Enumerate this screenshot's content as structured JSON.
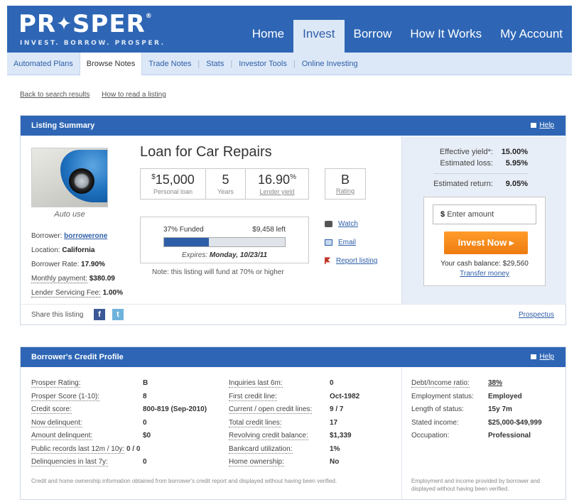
{
  "brand": {
    "logo_left": "PR",
    "logo_right": "SPER",
    "tagline": "INVEST. BORROW. PROSPER."
  },
  "nav": [
    "Home",
    "Invest",
    "Borrow",
    "How It Works",
    "My Account"
  ],
  "subnav": [
    "Automated Plans",
    "Browse Notes",
    "Trade Notes",
    "Stats",
    "Investor Tools",
    "Online Investing"
  ],
  "crumbs": [
    "Back to search results",
    "How to read a listing"
  ],
  "listing": {
    "header": "Listing Summary",
    "help": "Help",
    "title": "Loan for Car Repairs",
    "image_caption": "Auto use",
    "amount": {
      "prefix": "$",
      "value": "15,000",
      "label": "Personal loan"
    },
    "years": {
      "value": "5",
      "label": "Years"
    },
    "lender_yield": {
      "value": "16.90",
      "unit": "%",
      "label": "Lender yield"
    },
    "rating": {
      "value": "B",
      "label": "Rating"
    },
    "funded_label": "37% Funded",
    "funded_fraction": 0.37,
    "left_label": "$9,458 left",
    "expires_label": "Expires:",
    "expires_value": "Monday, 10/23/11",
    "fund_note": "Note: this listing will fund at 70% or higher",
    "actions": [
      "Watch",
      "Email",
      "Report listing"
    ],
    "borrower": [
      {
        "k": "Borrower:",
        "v": "borrowerone"
      },
      {
        "k": "Location:",
        "v": "California"
      },
      {
        "k": "Borrower Rate:",
        "v": "17.90%"
      },
      {
        "k": "Monthly payment:",
        "v": "$380.09"
      },
      {
        "k": "Lender Servicing Fee:",
        "v": "1.00%"
      }
    ],
    "effective_yield_label": "Effective yield*:",
    "effective_yield": "15.00%",
    "estimated_loss_label": "Estimated loss:",
    "estimated_loss": "5.95%",
    "estimated_return_label": "Estimated return:",
    "estimated_return": "9.05%",
    "amount_placeholder": "Enter amount",
    "amount_currency": "$",
    "invest_button": "Invest Now",
    "cash_balance": "Your cash balance: $29,560",
    "transfer": "Transfer money",
    "share_label": "Share this listing",
    "prospectus": "Prospectus"
  },
  "credit": {
    "header": "Borrower's Credit Profile",
    "help": "Help",
    "col1": [
      {
        "k": "Prosper Rating:",
        "v": "B"
      },
      {
        "k": "Prosper Score (1-10):",
        "v": "8"
      },
      {
        "k": "Credit score:",
        "v": "800-819 (Sep-2010)"
      },
      {
        "k": "Now delinquent:",
        "v": "0"
      },
      {
        "k": "Amount delinquent:",
        "v": "$0"
      },
      {
        "k": "Public records last 12m / 10y:",
        "v": "0 / 0"
      },
      {
        "k": "Delinquencies in last 7y:",
        "v": "0"
      }
    ],
    "col2": [
      {
        "k": "Inquiries last 6m:",
        "v": "0"
      },
      {
        "k": "First credit line:",
        "v": "Oct-1982"
      },
      {
        "k": "Current / open credit lines:",
        "v": "9 / 7"
      },
      {
        "k": "Total credit lines:",
        "v": "17"
      },
      {
        "k": "Revolving credit balance:",
        "v": "$1,339"
      },
      {
        "k": "Bankcard utilization:",
        "v": "1%"
      },
      {
        "k": "Home ownership:",
        "v": "No"
      }
    ],
    "col3": [
      {
        "k": "Debt/Income ratio:",
        "v": "38%"
      },
      {
        "k": "Employment status:",
        "v": "Employed"
      },
      {
        "k": "Length of status:",
        "v": "15y 7m"
      },
      {
        "k": "Stated income:",
        "v": "$25,000-$49,999"
      },
      {
        "k": "Occupation:",
        "v": "Professional"
      }
    ],
    "note_left": "Credit and home ownership information obtained from borrower's credit report and displayed without having been verified.",
    "note_right": "Employment and income provided by borrower and displayed without having been verified."
  },
  "colors": {
    "brand_blue": "#2e66b5",
    "subnav_bg": "#dce8f7",
    "invest_orange": "#f28a1c",
    "link": "#2e5ea8"
  },
  "icons": [
    "star-logo-icon",
    "watch-icon",
    "email-icon",
    "report-flag-icon",
    "facebook-icon",
    "twitter-icon",
    "help-icon",
    "arrow-right-icon"
  ]
}
